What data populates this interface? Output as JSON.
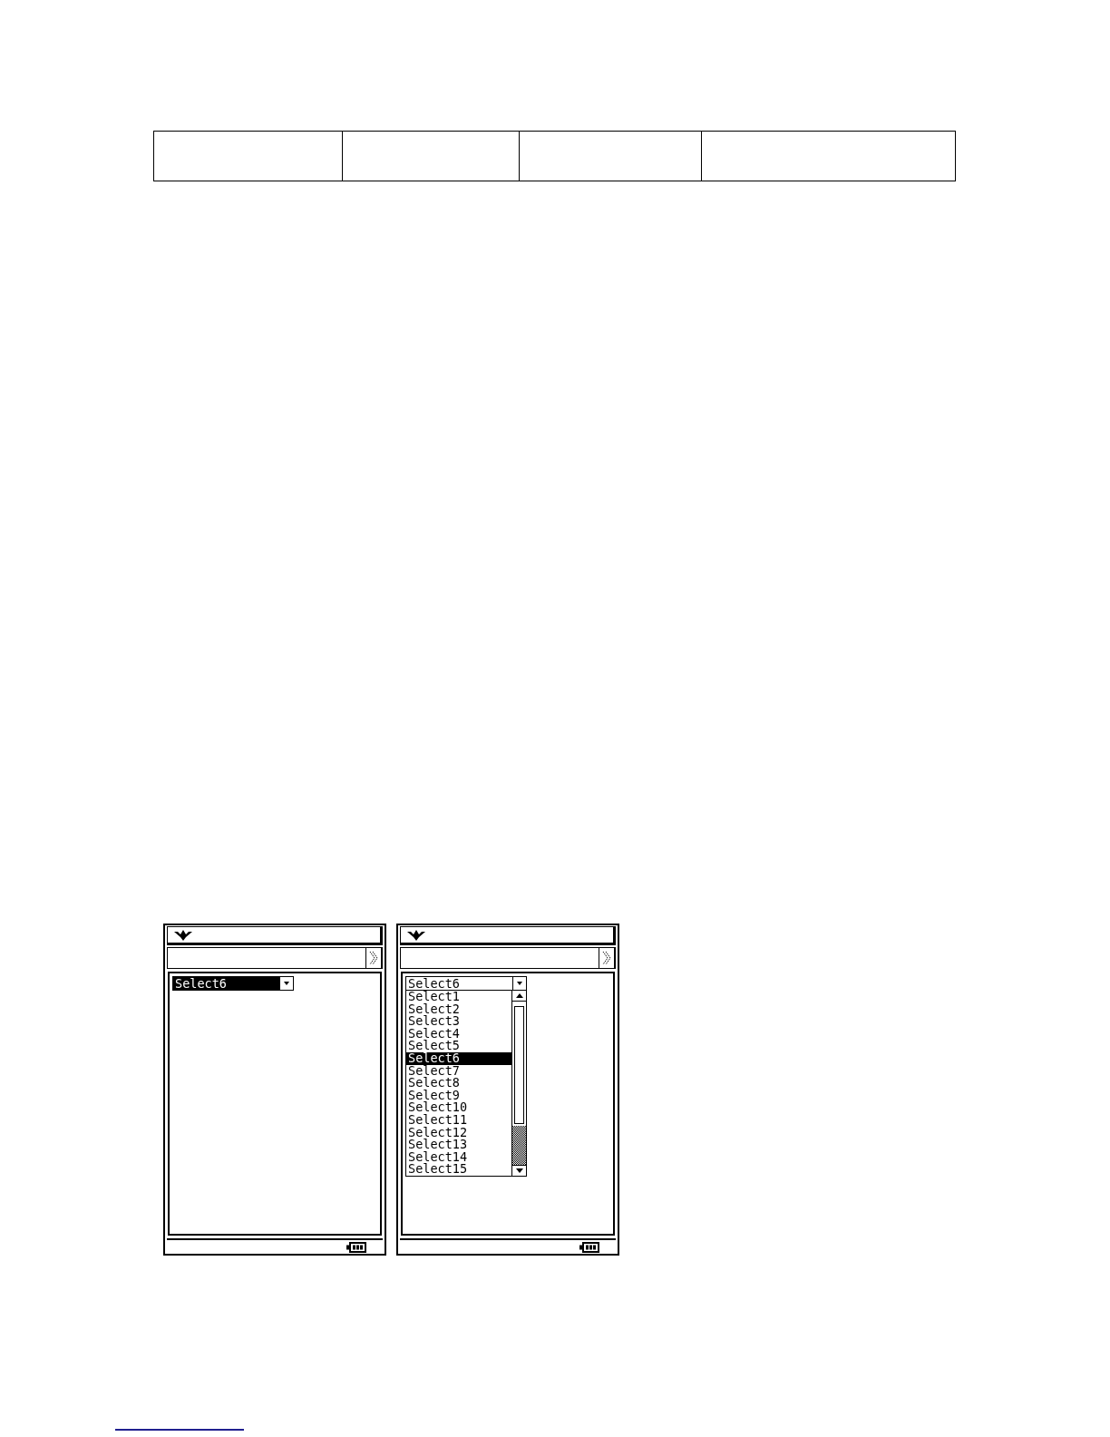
{
  "screens": [
    {
      "dropdown": {
        "value": "Select6",
        "focused": true,
        "expanded": false
      }
    },
    {
      "dropdown": {
        "value": "Select6",
        "focused": false,
        "expanded": true,
        "options": [
          {
            "label": "Select1",
            "selected": false
          },
          {
            "label": "Select2",
            "selected": false
          },
          {
            "label": "Select3",
            "selected": false
          },
          {
            "label": "Select4",
            "selected": false
          },
          {
            "label": "Select5",
            "selected": false
          },
          {
            "label": "Select6",
            "selected": true
          },
          {
            "label": "Select7",
            "selected": false
          },
          {
            "label": "Select8",
            "selected": false
          },
          {
            "label": "Select9",
            "selected": false
          },
          {
            "label": "Select10",
            "selected": false
          },
          {
            "label": "Select11",
            "selected": false
          },
          {
            "label": "Select12",
            "selected": false
          },
          {
            "label": "Select13",
            "selected": false
          },
          {
            "label": "Select14",
            "selected": false
          },
          {
            "label": "Select15",
            "selected": false
          }
        ]
      }
    }
  ]
}
